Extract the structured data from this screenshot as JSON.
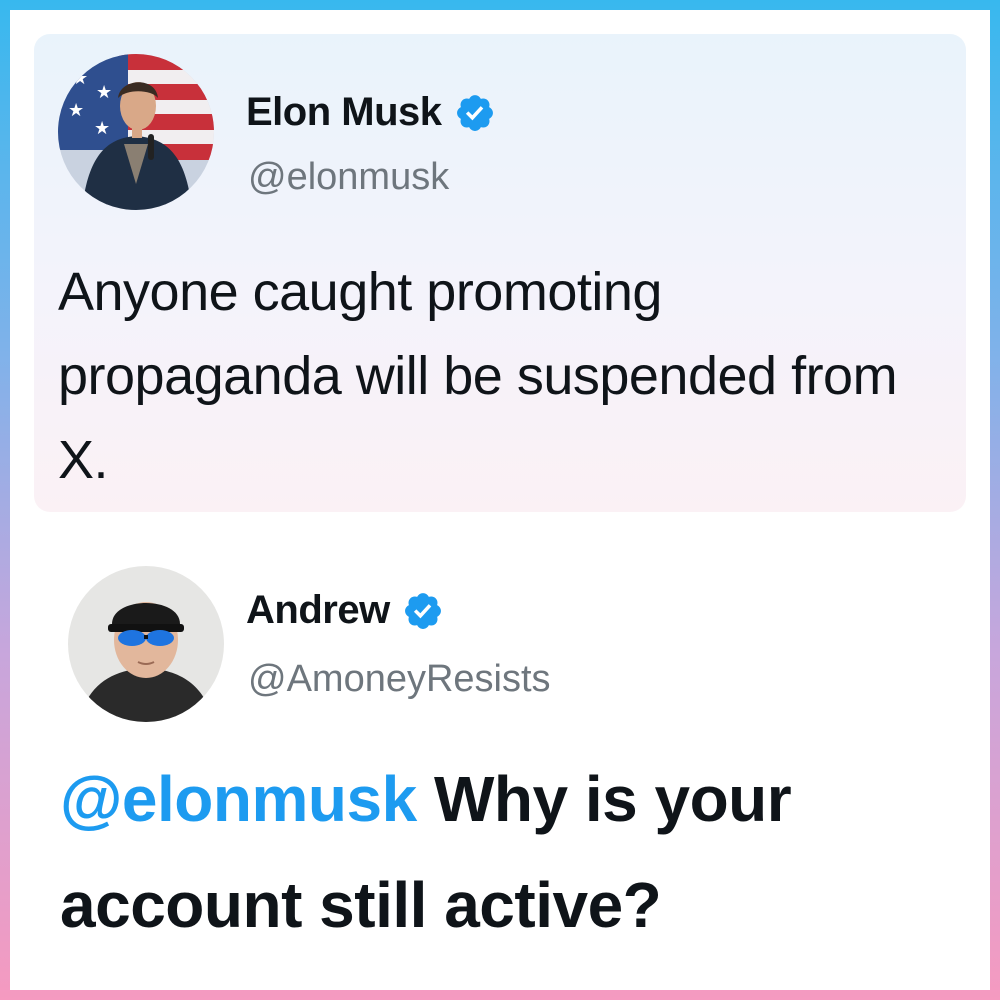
{
  "colors": {
    "border_top": "#38b8ee",
    "border_bottom": "#f59ac0",
    "verified_badge": "#1d9bf0",
    "mention": "#1d9bf0",
    "handle_text": "#6e767d"
  },
  "tweets": [
    {
      "name": "Elon Musk",
      "handle": "@elonmusk",
      "verified": true,
      "text": "Anyone caught promoting propaganda will be suspended from X."
    },
    {
      "name": "Andrew",
      "handle": "@AmoneyResists",
      "verified": true,
      "mention": "@elonmusk",
      "text": " Why is your account still active?"
    }
  ]
}
